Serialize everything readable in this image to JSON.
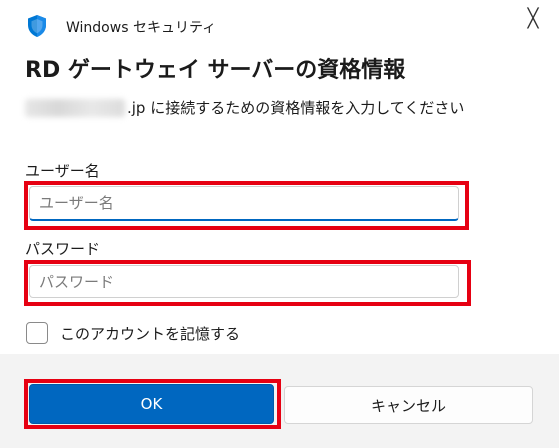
{
  "window": {
    "app_title": "Windows セキュリティ",
    "close_glyph": "╳",
    "icon": "shield-icon"
  },
  "dialog": {
    "heading": "RD ゲートウェイ サーバーの資格情報",
    "message_suffix": ".jp に接続するための資格情報を入力してください"
  },
  "username": {
    "label": "ユーザー名",
    "placeholder": "ユーザー名",
    "value": ""
  },
  "password": {
    "label": "パスワード",
    "placeholder": "パスワード",
    "value": ""
  },
  "remember": {
    "label": "このアカウントを記憶する",
    "checked": false
  },
  "buttons": {
    "ok_label": "OK",
    "cancel_label": "キャンセル"
  },
  "colors": {
    "accent": "#0067c0",
    "highlight": "#e60012",
    "footer_bg": "#f3f3f3"
  }
}
